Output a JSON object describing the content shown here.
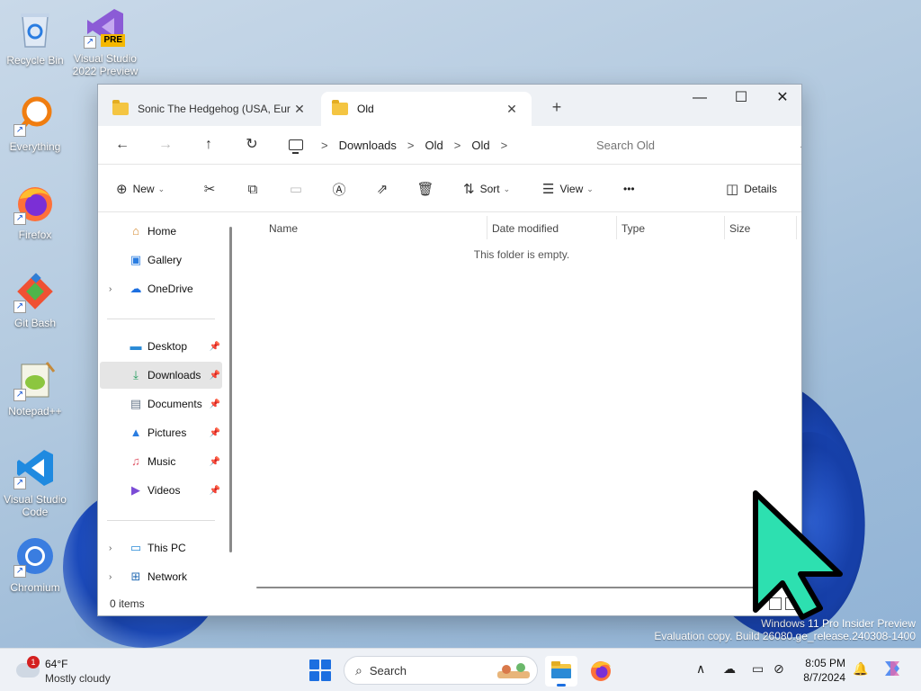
{
  "desktop": {
    "icons": [
      {
        "label_1": "Recycle Bin",
        "label_2": ""
      },
      {
        "label_1": "Visual Studio",
        "label_2": "2022 Preview",
        "badge": "PRE"
      },
      {
        "label_1": "Everything",
        "label_2": ""
      },
      {
        "label_1": "Firefox",
        "label_2": ""
      },
      {
        "label_1": "Git Bash",
        "label_2": ""
      },
      {
        "label_1": "Notepad++",
        "label_2": ""
      },
      {
        "label_1": "Visual Studio",
        "label_2": "Code"
      },
      {
        "label_1": "Chromium",
        "label_2": ""
      }
    ],
    "watermark_line1": "Windows 11 Pro Insider Preview",
    "watermark_line2": "Evaluation copy. Build 26080.ge_release.240308-1400"
  },
  "explorer": {
    "tabs": [
      {
        "label": "Sonic The Hedgehog (USA, Euro",
        "close": "✕"
      },
      {
        "label": "Old",
        "close": "✕"
      }
    ],
    "new_tab": "+",
    "window_controls": {
      "minimize": "—",
      "maximize": "☐",
      "close": "✕"
    },
    "nav": {
      "back": "←",
      "forward": "→",
      "up": "↑",
      "refresh": "↻"
    },
    "breadcrumb": [
      "Downloads",
      "Old",
      "Old"
    ],
    "breadcrumb_sep": ">",
    "search_placeholder": "Search Old",
    "toolbar": {
      "new_label": "New",
      "sort_label": "Sort",
      "view_label": "View",
      "more_label": "•••",
      "details_label": "Details"
    },
    "sidebar": {
      "home": "Home",
      "gallery": "Gallery",
      "onedrive": "OneDrive",
      "desktop": "Desktop",
      "downloads": "Downloads",
      "documents": "Documents",
      "pictures": "Pictures",
      "music": "Music",
      "videos": "Videos",
      "this_pc": "This PC",
      "network": "Network"
    },
    "columns": {
      "name": "Name",
      "date_modified": "Date modified",
      "type": "Type",
      "size": "Size"
    },
    "empty_message": "This folder is empty.",
    "status": "0 items"
  },
  "taskbar": {
    "weather_temp": "64°F",
    "weather_cond": "Mostly cloudy",
    "weather_badge": "1",
    "search_label": "Search",
    "time": "8:05 PM",
    "date": "8/7/2024"
  },
  "colors": {
    "accent": "#1c6fe0",
    "cursor": "#2de0b0"
  }
}
